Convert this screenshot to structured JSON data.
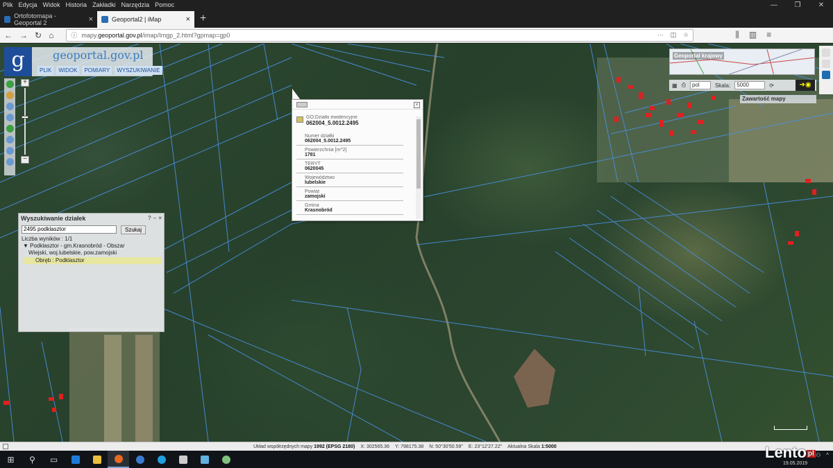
{
  "browser": {
    "menu": [
      "Plik",
      "Edycja",
      "Widok",
      "Historia",
      "Zakładki",
      "Narzędzia",
      "Pomoc"
    ],
    "tabs": [
      {
        "title": "Ortofotomapa - Geoportal 2"
      },
      {
        "title": "Geoportal2 | iMap"
      }
    ],
    "url_prefix": "mapy.",
    "url_host": "geoportal.gov.pl",
    "url_path": "/imap/Imgp_2.html?gpmap=gp0"
  },
  "app": {
    "logo_letter": "g",
    "logo_name": "geoportal.gov.pl",
    "menu": [
      "PLIK",
      "WIDOK",
      "POMIARY",
      "WYSZUKIWANIE"
    ],
    "overview_title": "Geoportal krajowy",
    "lang": "pol",
    "scale_label": "Skala:",
    "scale_value": "5000",
    "contents_label": "Zawartość mapy"
  },
  "popup": {
    "layer_name": "GO:Dzialki ewidencyjne",
    "layer_value": "062004_5.0012.2495",
    "attributes": [
      {
        "key": "Numer działki",
        "value": "062004_5.0012.2495"
      },
      {
        "key": "Powierzchnia [m^2]",
        "value": "1781"
      },
      {
        "key": "TERYT",
        "value": "0620045"
      },
      {
        "key": "Województwo",
        "value": "lubelskie"
      },
      {
        "key": "Powiat",
        "value": "zamojski"
      },
      {
        "key": "Gmina",
        "value": "Krasnobród"
      }
    ]
  },
  "search": {
    "title": "Wyszukiwanie działek",
    "controls": [
      "?",
      "–",
      "×"
    ],
    "query": "2495  podklasztor",
    "button": "Szukaj",
    "count": "Liczba wyników : 1/1",
    "result_line1": "▼ Podklasztor - gm.Krasnobród - Obszar",
    "result_line2": "Wiejski, woj.lubelskie, pow.zamojski",
    "result_sub": "Obręb : Podklasztor"
  },
  "status": {
    "crs_label": "Układ współrzędnych mapy",
    "crs_value": "1992 (EPSG 2180)",
    "x": "X: 302565.36",
    "y": "Y: 798175.38",
    "n": "N: 50°30'50.59\"",
    "e": "E: 23°12'27.22\"",
    "scale_label": "Aktualna Skala",
    "scale_value": "1:5000"
  },
  "watermark": {
    "brand": "Lento",
    "tld": "pl",
    "date": "19.05.2019"
  }
}
